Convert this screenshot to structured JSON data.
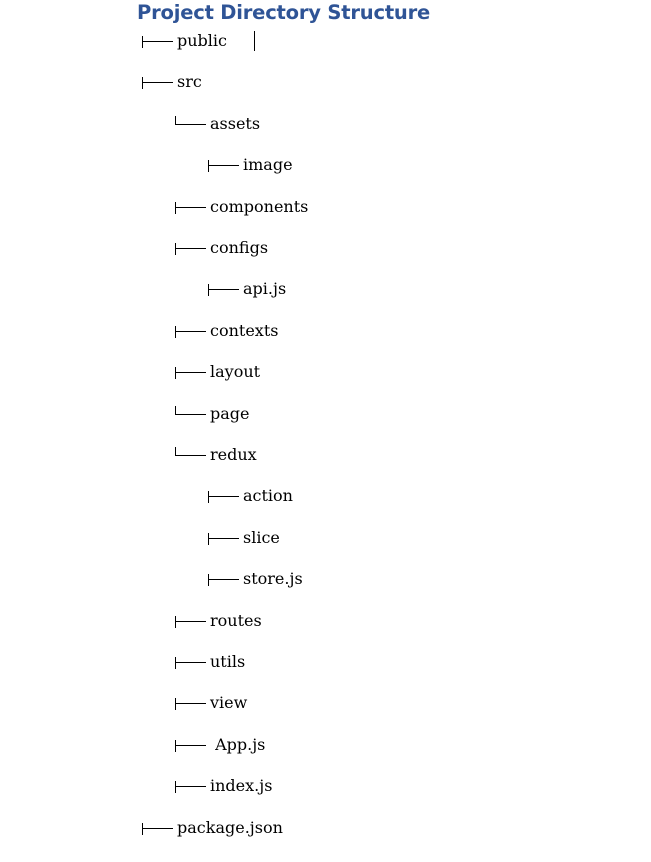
{
  "title": "Project Directory Structure",
  "tree": [
    {
      "label": "public",
      "depth": 0,
      "connector": "tee"
    },
    {
      "label": "src",
      "depth": 0,
      "connector": "tee"
    },
    {
      "label": "assets",
      "depth": 1,
      "connector": "elbow"
    },
    {
      "label": "image",
      "depth": 2,
      "connector": "tee"
    },
    {
      "label": "components",
      "depth": 1,
      "connector": "tee"
    },
    {
      "label": "configs",
      "depth": 1,
      "connector": "tee"
    },
    {
      "label": "api.js",
      "depth": 2,
      "connector": "tee"
    },
    {
      "label": "contexts",
      "depth": 1,
      "connector": "tee"
    },
    {
      "label": "layout",
      "depth": 1,
      "connector": "tee"
    },
    {
      "label": "page",
      "depth": 1,
      "connector": "elbow"
    },
    {
      "label": "redux",
      "depth": 1,
      "connector": "elbow"
    },
    {
      "label": "action",
      "depth": 2,
      "connector": "tee"
    },
    {
      "label": "slice",
      "depth": 2,
      "connector": "tee"
    },
    {
      "label": "store.js",
      "depth": 2,
      "connector": "tee"
    },
    {
      "label": "routes",
      "depth": 1,
      "connector": "tee"
    },
    {
      "label": "utils",
      "depth": 1,
      "connector": "tee"
    },
    {
      "label": "view",
      "depth": 1,
      "connector": "tee"
    },
    {
      "label": " App.js",
      "depth": 1,
      "connector": "tee"
    },
    {
      "label": "index.js",
      "depth": 1,
      "connector": "tee"
    },
    {
      "label": "package.json",
      "depth": 0,
      "connector": "tee"
    }
  ]
}
